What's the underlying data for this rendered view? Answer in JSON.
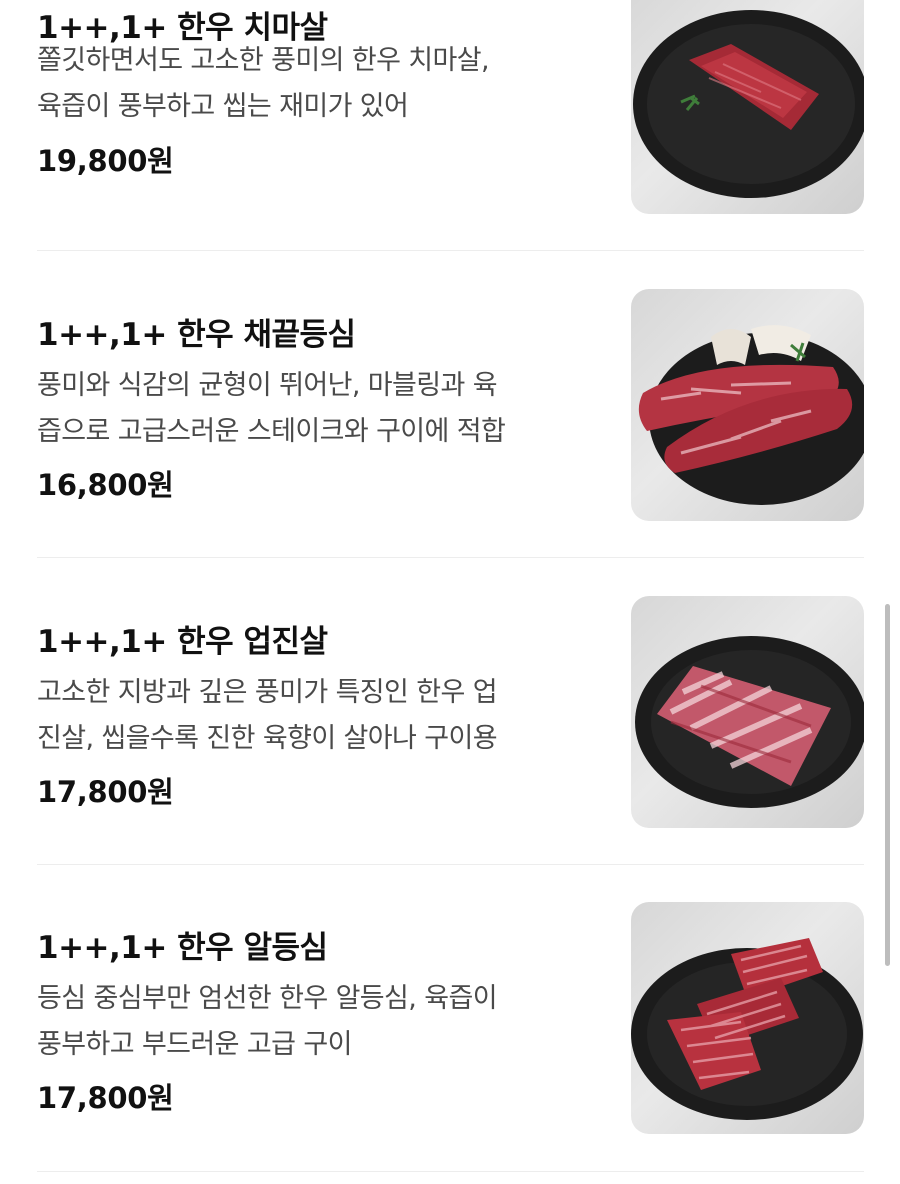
{
  "menu": {
    "items": [
      {
        "title": "1++,1+ 한우 치마살",
        "description_lines": [
          "쫄깃하면서도 고소한 풍미의 한우 치마살,",
          "육즙이 풍부하고 씹는 재미가 있어"
        ],
        "price": "19,800원",
        "image": "hanwoo-chimasal-photo"
      },
      {
        "title": "1++,1+ 한우 채끝등심",
        "description_lines": [
          "풍미와 식감의 균형이 뛰어난, 마블링과 육",
          "즙으로 고급스러운 스테이크와 구이에 적합"
        ],
        "price": "16,800원",
        "image": "hanwoo-chaekkeut-deungsim-photo"
      },
      {
        "title": "1++,1+ 한우 업진살",
        "description_lines": [
          "고소한 지방과 깊은 풍미가 특징인 한우 업",
          "진살, 씹을수록 진한 육향이 살아나 구이용"
        ],
        "price": "17,800원",
        "image": "hanwoo-eopjinsal-photo"
      },
      {
        "title": "1++,1+ 한우 알등심",
        "description_lines": [
          "등심 중심부만 엄선한 한우 알등심, 육즙이",
          "풍부하고 부드러운 고급 구이"
        ],
        "price": "17,800원",
        "image": "hanwoo-aldeungsim-photo"
      }
    ]
  },
  "colors": {
    "title": "#111111",
    "description": "#4a4a4a",
    "divider": "#ededed",
    "plate": "#1c1c1c",
    "meat": "#b0303c",
    "scrollbar": "#bdbdbd"
  }
}
